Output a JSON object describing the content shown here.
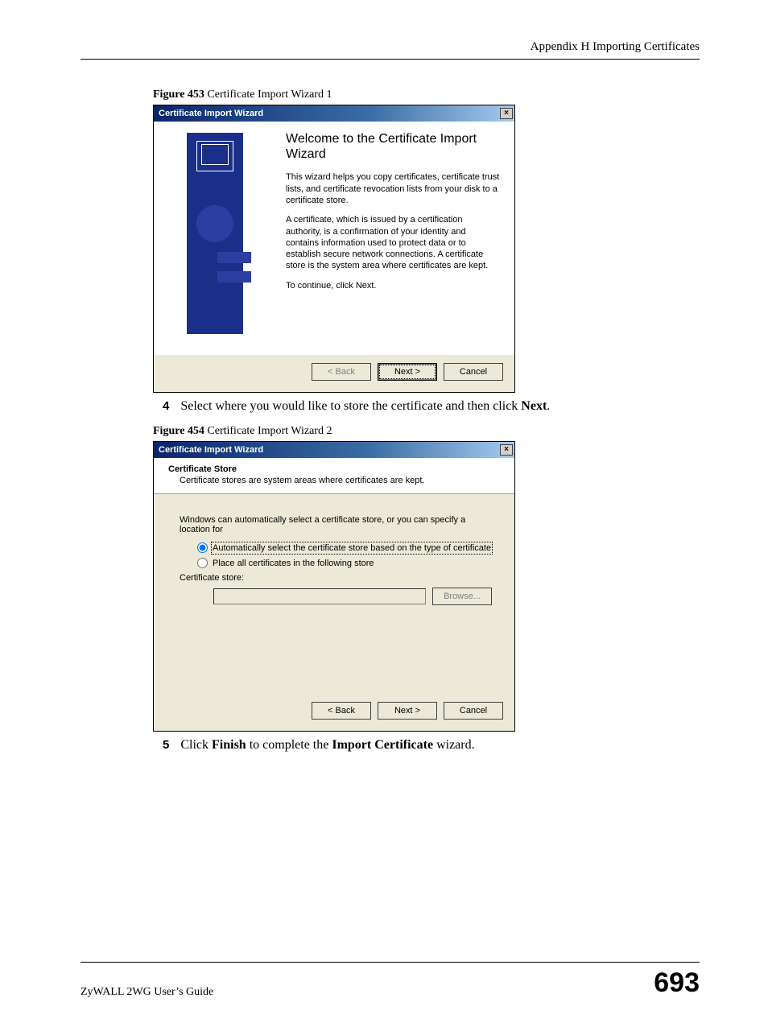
{
  "header": {
    "section": "Appendix H Importing Certificates"
  },
  "figure1": {
    "label_bold": "Figure 453",
    "label_rest": "   Certificate Import Wizard 1",
    "dialog": {
      "title": "Certificate Import Wizard",
      "heading": "Welcome to the Certificate Import Wizard",
      "p1": "This wizard helps you copy certificates, certificate trust lists, and certificate revocation lists from your disk to a certificate store.",
      "p2": "A certificate, which is issued by a certification authority, is a confirmation of your identity and contains information used to protect data or to establish secure network connections. A certificate store is the system area where certificates are kept.",
      "p3": "To continue, click Next.",
      "buttons": {
        "back": "< Back",
        "next": "Next >",
        "cancel": "Cancel"
      }
    }
  },
  "step4": {
    "num": "4",
    "pre": "Select where you would like to store the certificate and then click ",
    "bold": "Next",
    "post": "."
  },
  "figure2": {
    "label_bold": "Figure 454",
    "label_rest": "   Certificate Import Wizard 2",
    "dialog": {
      "title": "Certificate Import Wizard",
      "header_title": "Certificate Store",
      "header_sub": "Certificate stores are system areas where certificates are kept.",
      "body_p": "Windows can automatically select a certificate store, or you can specify a location for",
      "radio1": "Automatically select the certificate store based on the type of certificate",
      "radio2": "Place all certificates in the following store",
      "store_label": "Certificate store:",
      "browse": "Browse...",
      "buttons": {
        "back": "< Back",
        "next": "Next >",
        "cancel": "Cancel"
      }
    }
  },
  "step5": {
    "num": "5",
    "pre": "Click ",
    "bold1": "Finish",
    "mid": " to complete the ",
    "bold2": "Import Certificate",
    "post": " wizard."
  },
  "footer": {
    "guide": "ZyWALL 2WG User’s Guide",
    "page": "693"
  }
}
